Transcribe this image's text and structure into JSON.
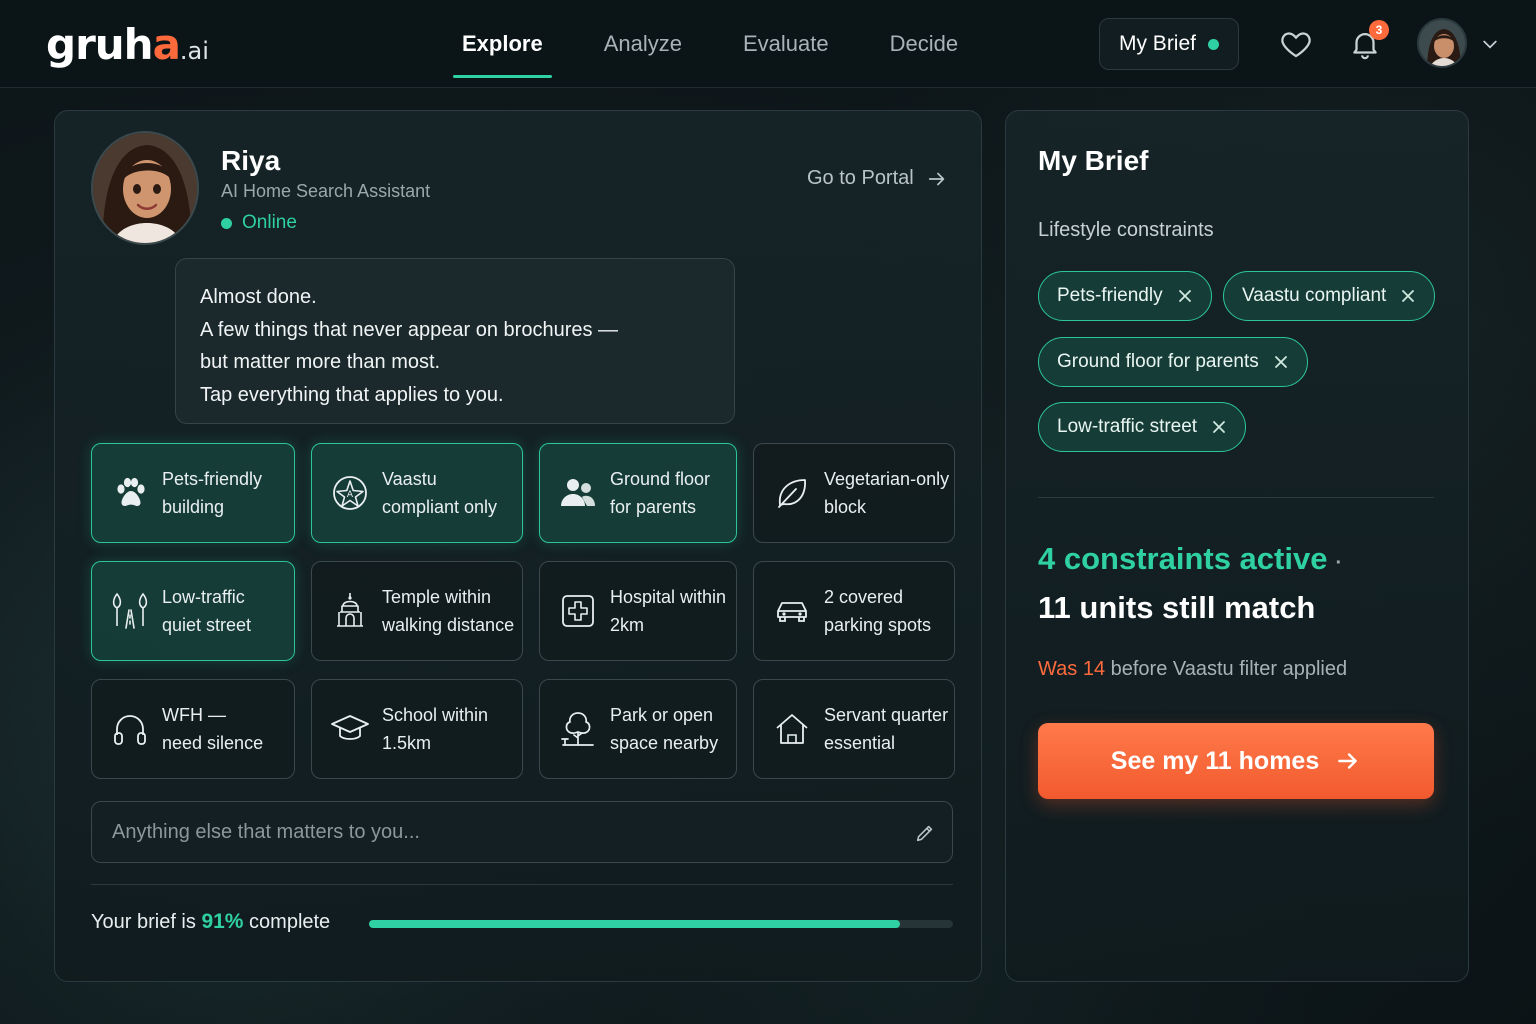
{
  "brand": {
    "name_main": "gruh",
    "name_accent": "a",
    "name_suffix": ".ai"
  },
  "nav": {
    "items": [
      {
        "label": "Explore",
        "active": true
      },
      {
        "label": "Analyze",
        "active": false
      },
      {
        "label": "Evaluate",
        "active": false
      },
      {
        "label": "Decide",
        "active": false
      }
    ]
  },
  "header": {
    "brief_button_label": "My Brief",
    "notifications_count": "3",
    "icons": [
      "heart-icon",
      "bell-icon",
      "avatar",
      "chevron-down-icon"
    ]
  },
  "assistant": {
    "name": "Riya",
    "role": "AI Home Search Assistant",
    "status": "Online",
    "portal_link": "Go to Portal",
    "message_lines": [
      "Almost done.",
      "A few things that never appear on brochures —",
      "but matter more than most.",
      "Tap everything that applies to you."
    ]
  },
  "options": [
    {
      "line1": "Pets-friendly",
      "line2": "building",
      "icon": "paw-icon",
      "selected": true
    },
    {
      "line1": "Vaastu",
      "line2": "compliant only",
      "icon": "compass-icon",
      "selected": true
    },
    {
      "line1": "Ground floor",
      "line2": "for parents",
      "icon": "people-icon",
      "selected": true
    },
    {
      "line1": "Vegetarian-only",
      "line2": "block",
      "icon": "leaf-icon",
      "selected": false
    },
    {
      "line1": "Low-traffic",
      "line2": "quiet street",
      "icon": "trees-road-icon",
      "selected": true
    },
    {
      "line1": "Temple within",
      "line2": "walking distance",
      "icon": "temple-icon",
      "selected": false
    },
    {
      "line1": "Hospital within",
      "line2": "2km",
      "icon": "hospital-icon",
      "selected": false
    },
    {
      "line1": "2 covered",
      "line2": "parking spots",
      "icon": "car-icon",
      "selected": false
    },
    {
      "line1": "WFH —",
      "line2": "need silence",
      "icon": "headphones-icon",
      "selected": false
    },
    {
      "line1": "School within",
      "line2": "1.5km",
      "icon": "graduation-cap-icon",
      "selected": false
    },
    {
      "line1": "Park or open",
      "line2": "space nearby",
      "icon": "park-tree-icon",
      "selected": false
    },
    {
      "line1": "Servant quarter",
      "line2": "essential",
      "icon": "house-icon",
      "selected": false
    }
  ],
  "input": {
    "placeholder": "Anything else that matters to you...",
    "value": ""
  },
  "progress": {
    "prefix": "Your brief is",
    "percent_label": "91%",
    "suffix": "complete",
    "fraction": 0.91
  },
  "brief": {
    "title": "My Brief",
    "subtitle": "Lifestyle constraints",
    "chips": [
      "Pets-friendly",
      "Vaastu compliant",
      "Ground floor for parents",
      "Low-traffic street"
    ],
    "constraints_active": "4 constraints active",
    "separator": "·",
    "units_match": "11 units still match",
    "was_prefix": "Was 14",
    "was_suffix": "before Vaastu filter applied",
    "cta_label": "See my 11 homes"
  },
  "colors": {
    "accent": "#2fd0a4",
    "brand_orange": "#ff6a3d",
    "background": "#0f191c"
  }
}
